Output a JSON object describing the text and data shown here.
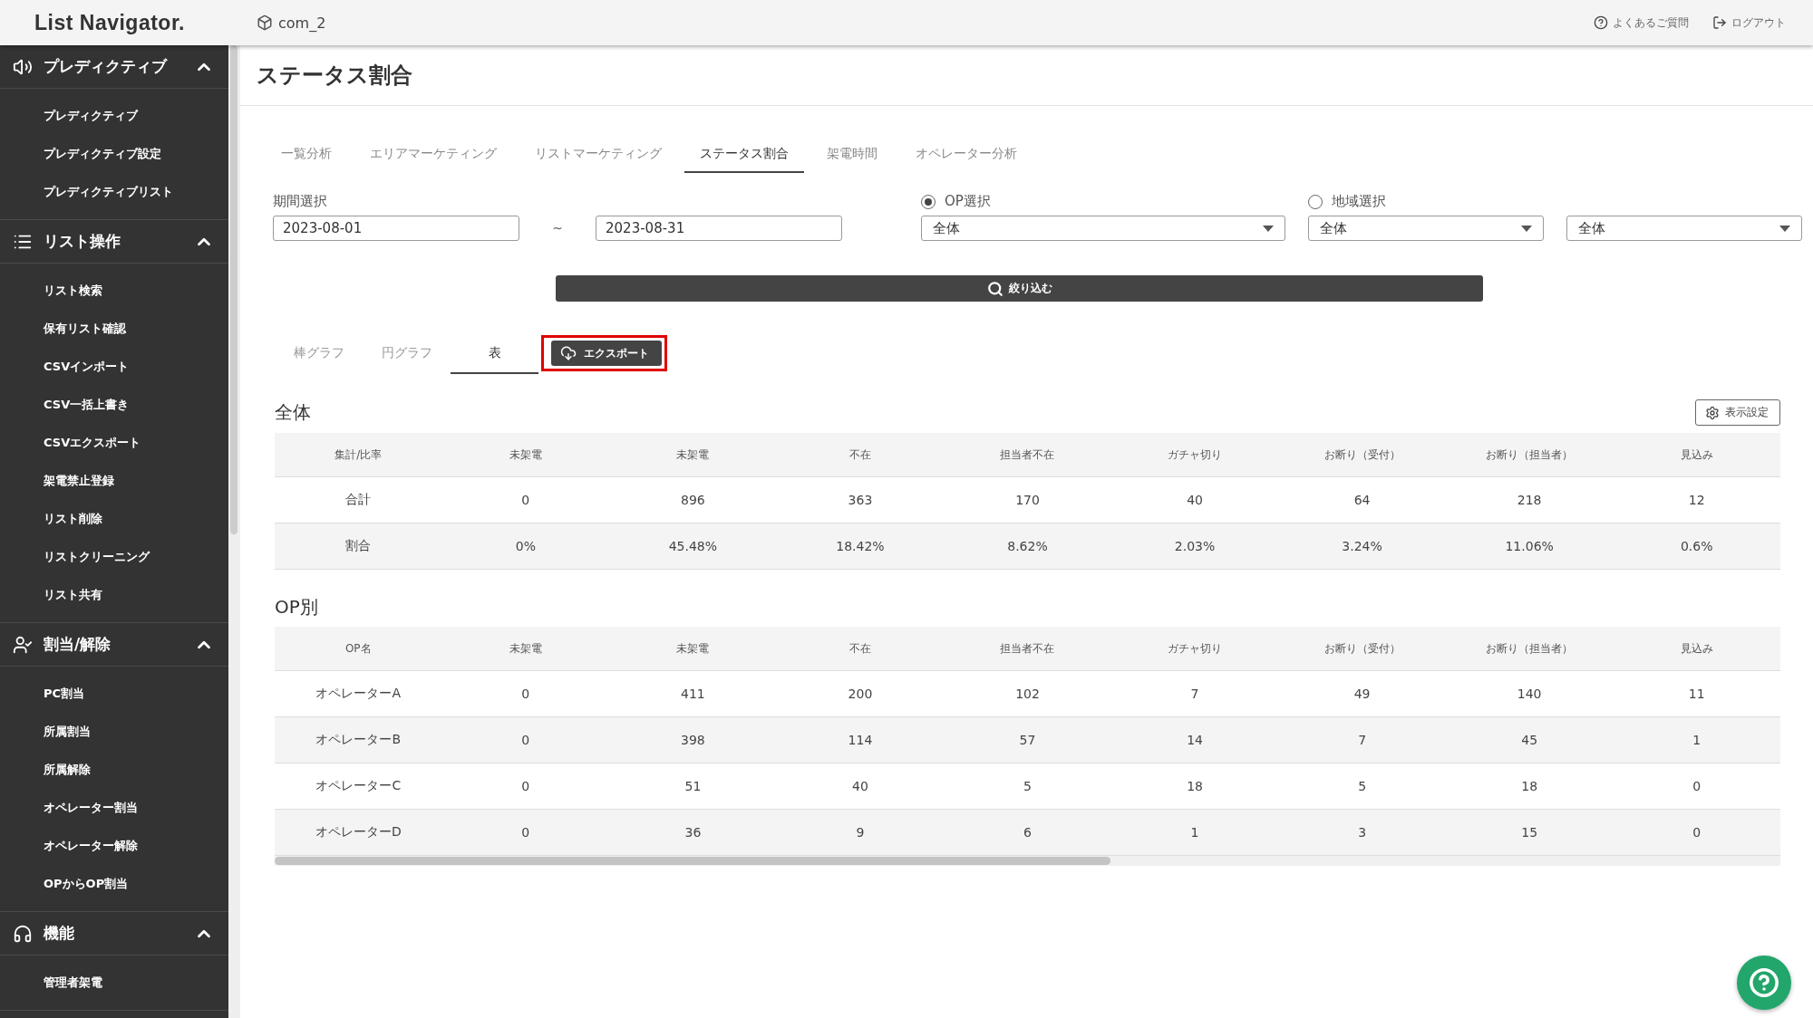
{
  "header": {
    "logo": "List Navigator.",
    "company": "com_2",
    "links": [
      {
        "kind": "help",
        "label": "よくあるご質問"
      },
      {
        "kind": "logout",
        "label": "ログアウト"
      }
    ]
  },
  "sidebar": {
    "sections": [
      {
        "kind": "predictive",
        "title": "プレディクティブ",
        "expanded": true,
        "items": [
          "プレディクティブ",
          "プレディクティブ設定",
          "プレディクティブリスト"
        ]
      },
      {
        "kind": "list",
        "title": "リスト操作",
        "expanded": true,
        "items": [
          "リスト検索",
          "保有リスト確認",
          "CSVインポート",
          "CSV一括上書き",
          "CSVエクスポート",
          "架電禁止登録",
          "リスト削除",
          "リストクリーニング",
          "リスト共有"
        ]
      },
      {
        "kind": "assign",
        "title": "割当/解除",
        "expanded": true,
        "items": [
          "PC割当",
          "所属割当",
          "所属解除",
          "オペレーター割当",
          "オペレーター解除",
          "OPからOP割当"
        ]
      },
      {
        "kind": "function",
        "title": "機能",
        "expanded": true,
        "items": [
          "管理者架電"
        ]
      }
    ]
  },
  "page_title": "ステータス割合",
  "tabs": [
    {
      "label": "一覧分析",
      "selected": false
    },
    {
      "label": "エリアマーケティング",
      "selected": false
    },
    {
      "label": "リストマーケティング",
      "selected": false
    },
    {
      "label": "ステータス割合",
      "selected": true
    },
    {
      "label": "架電時間",
      "selected": false
    },
    {
      "label": "オペレーター分析",
      "selected": false
    }
  ],
  "filters": {
    "period_label": "期間選択",
    "date_from": "2023-08-01",
    "separator": "~",
    "date_to": "2023-08-31",
    "modes": [
      {
        "label": "OP選択",
        "selected": true
      },
      {
        "label": "地域選択",
        "selected": false
      }
    ],
    "selects": [
      "全体",
      "全体",
      "全体"
    ],
    "search_button": "絞り込む"
  },
  "view_tabs": [
    {
      "label": "棒グラフ",
      "selected": false
    },
    {
      "label": "円グラフ",
      "selected": false
    },
    {
      "label": "表",
      "selected": true
    }
  ],
  "export_button": {
    "label": "エクスポート",
    "highlighted": true
  },
  "display_settings_button": "表示設定",
  "tables": [
    {
      "title": "全体",
      "columns": [
        "集計/比率",
        "未架電",
        "未架電",
        "不在",
        "担当者不在",
        "ガチャ切り",
        "お断り（受付）",
        "お断り（担当者）",
        "見込み"
      ],
      "rows": [
        [
          "合計",
          "0",
          "896",
          "363",
          "170",
          "40",
          "64",
          "218",
          "12"
        ],
        [
          "割合",
          "0%",
          "45.48%",
          "18.42%",
          "8.62%",
          "2.03%",
          "3.24%",
          "11.06%",
          "0.6%"
        ]
      ]
    },
    {
      "title": "OP別",
      "columns": [
        "OP名",
        "未架電",
        "未架電",
        "不在",
        "担当者不在",
        "ガチャ切り",
        "お断り（受付）",
        "お断り（担当者）",
        "見込み"
      ],
      "rows": [
        [
          "オペレーターA",
          "0",
          "411",
          "200",
          "102",
          "7",
          "49",
          "140",
          "11"
        ],
        [
          "オペレーターB",
          "0",
          "398",
          "114",
          "57",
          "14",
          "7",
          "45",
          "1"
        ],
        [
          "オペレーターC",
          "0",
          "51",
          "40",
          "5",
          "18",
          "5",
          "18",
          "0"
        ],
        [
          "オペレーターD",
          "0",
          "36",
          "9",
          "6",
          "1",
          "3",
          "15",
          "0"
        ]
      ]
    }
  ]
}
